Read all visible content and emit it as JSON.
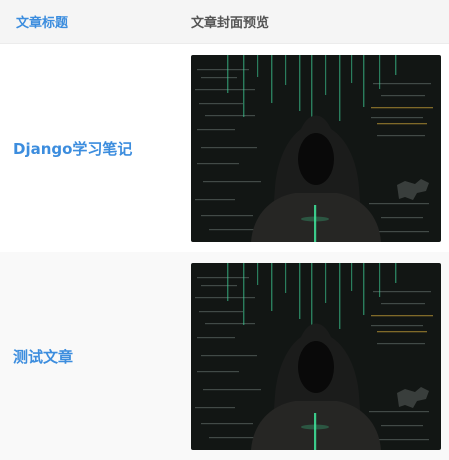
{
  "header": {
    "title_col": "文章标题",
    "cover_col": "文章封面预览"
  },
  "rows": [
    {
      "title": "Django学习笔记",
      "cover_icon": "hacker-code-cover-image"
    },
    {
      "title": "测试文章",
      "cover_icon": "hacker-code-cover-image"
    }
  ],
  "colors": {
    "link": "#3c8dde",
    "header_text": "#555555",
    "header_bg": "#f5f5f5",
    "alt_row_bg": "#f9f9f9"
  }
}
